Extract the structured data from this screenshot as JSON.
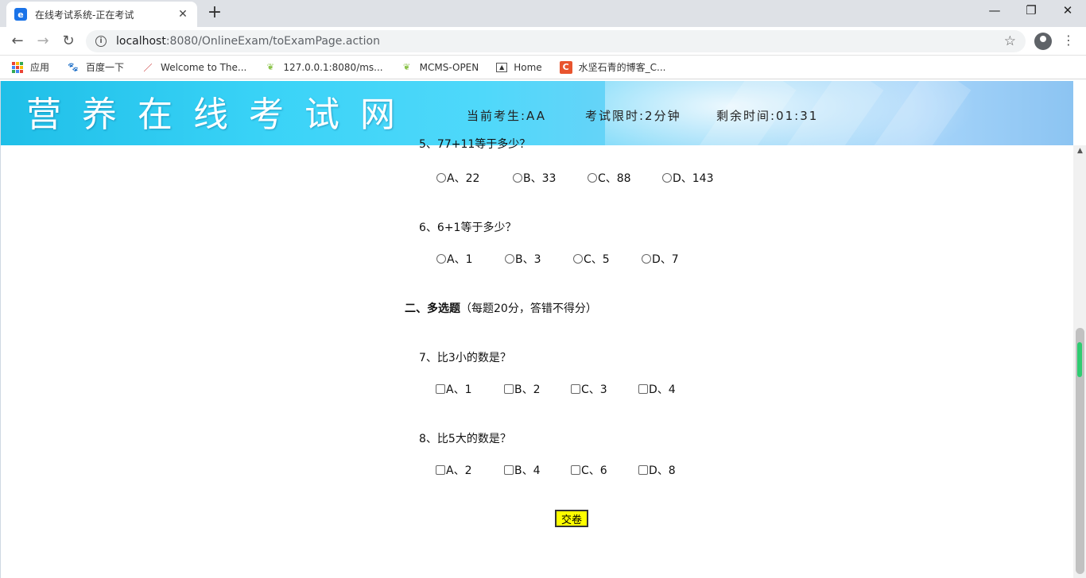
{
  "browser": {
    "tab_title": "在线考试系统-正在考试",
    "tab_favicon": "e",
    "url_host": "localhost",
    "url_rest": ":8080/OnlineExam/toExamPage.action",
    "bookmarks": [
      {
        "label": "应用",
        "icon": "apps-icon"
      },
      {
        "label": "百度一下",
        "icon": "baidu-paw-icon"
      },
      {
        "label": "Welcome to The...",
        "icon": "feather-icon"
      },
      {
        "label": "127.0.0.1:8080/ms...",
        "icon": "leaf-icon"
      },
      {
        "label": "MCMS-OPEN",
        "icon": "leaf-icon"
      },
      {
        "label": "Home",
        "icon": "image-icon"
      },
      {
        "label": "水坚石青的博客_C...",
        "icon": "csdn-icon"
      }
    ]
  },
  "banner": {
    "site_title": "营养在线考试网",
    "candidate": "当前考生:AA",
    "time_limit": "考试限时:2分钟",
    "remaining": "剩余时间:01:31"
  },
  "exam": {
    "q5": {
      "text_partial": "5、77+11等于多少？",
      "options": [
        "A、22",
        "B、33",
        "C、88",
        "D、143"
      ]
    },
    "q6": {
      "text": "6、6+1等于多少？",
      "options": [
        "A、1",
        "B、3",
        "C、5",
        "D、7"
      ]
    },
    "section2": {
      "title": "二、多选题",
      "note": "（每题20分，答错不得分）"
    },
    "q7": {
      "text": "7、比3小的数是？",
      "options": [
        "A、1",
        "B、2",
        "C、3",
        "D、4"
      ]
    },
    "q8": {
      "text": "8、比5大的数是？",
      "options": [
        "A、2",
        "B、4",
        "C、6",
        "D、8"
      ]
    },
    "submit_label": "交卷"
  },
  "colors": {
    "banner_accent": "#3ad3f7",
    "submit_bg": "#ffff00"
  }
}
